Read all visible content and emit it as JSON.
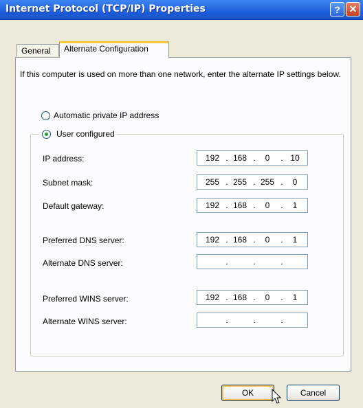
{
  "window": {
    "title": "Internet Protocol (TCP/IP) Properties",
    "help_label": "?",
    "close_label": "✕"
  },
  "tabs": [
    {
      "label": "General",
      "selected": false
    },
    {
      "label": "Alternate Configuration",
      "selected": true
    }
  ],
  "intro_text": "If this computer is used on more than one network, enter the alternate IP settings below.",
  "options": {
    "automatic": {
      "label": "Automatic private IP address",
      "selected": false
    },
    "user_configured": {
      "label": "User configured",
      "selected": true
    }
  },
  "fields": {
    "ip_address": {
      "label": "IP address:",
      "octets": [
        "192",
        "168",
        "0",
        "10"
      ]
    },
    "subnet_mask": {
      "label": "Subnet mask:",
      "octets": [
        "255",
        "255",
        "255",
        "0"
      ]
    },
    "default_gateway": {
      "label": "Default gateway:",
      "octets": [
        "192",
        "168",
        "0",
        "1"
      ]
    },
    "preferred_dns": {
      "label": "Preferred DNS server:",
      "octets": [
        "192",
        "168",
        "0",
        "1"
      ]
    },
    "alternate_dns": {
      "label": "Alternate DNS server:",
      "octets": [
        "",
        "",
        "",
        ""
      ]
    },
    "preferred_wins": {
      "label": "Preferred WINS server:",
      "octets": [
        "192",
        "168",
        "0",
        "1"
      ]
    },
    "alternate_wins": {
      "label": "Alternate WINS server:",
      "octets": [
        "",
        "",
        "",
        ""
      ]
    }
  },
  "buttons": {
    "ok": "OK",
    "cancel": "Cancel"
  },
  "colors": {
    "titlebar": "#1b5ad8",
    "dialog_bg": "#ece9d8",
    "radio_dot": "#21a121",
    "tab_highlight": "#ffc83c"
  }
}
